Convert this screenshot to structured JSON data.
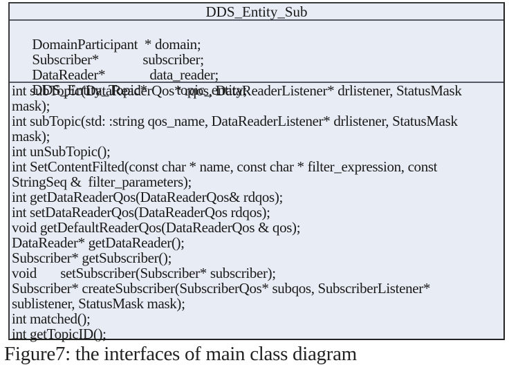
{
  "class_diagram": {
    "class_name": "DDS_Entity_Sub",
    "attributes": [
      {
        "type": "DomainParticipant  * ",
        "name": "domain;"
      },
      {
        "type": "Subscriber*",
        "name": "subscriber;"
      },
      {
        "type": "DataReader*",
        "name": "data_reader;"
      },
      {
        "type": "DDS_Entity_Topic*",
        "name": "topic_entity;"
      }
    ],
    "method_lines": [
      "int subTopic(DataReaderQos* rqos, DataReaderListener* drlistener, StatusMask",
      "mask);",
      "int subTopic(std: :string qos_name, DataReaderListener* drlistener, StatusMask",
      "mask);",
      "int unSubTopic();",
      "int SetContentFilted(const char * name, const char * filter_expression, const",
      "StringSeq &  filter_parameters);",
      "int getDataReaderQos(DataReaderQos& rdqos);",
      "int setDataReaderQos(DataReaderQos rdqos);",
      "void getDefaultReaderQos(DataReaderQos & qos);",
      "DataReader* getDataReader();",
      "Subscriber* getSubscriber();",
      "void       setSubscriber(Subscriber* subscriber);",
      "Subscriber* createSubscriber(SubscriberQos* subqos, SubscriberListener*",
      "sublistener, StatusMask mask);",
      "int matched();",
      "int getTopicID();"
    ]
  },
  "caption": "Figure7: the interfaces of main class diagram",
  "colors": {
    "box_fill": "#e8ecf5",
    "border": "#3a3a3a",
    "divider": "#555a66",
    "text": "#1a1a1a"
  }
}
